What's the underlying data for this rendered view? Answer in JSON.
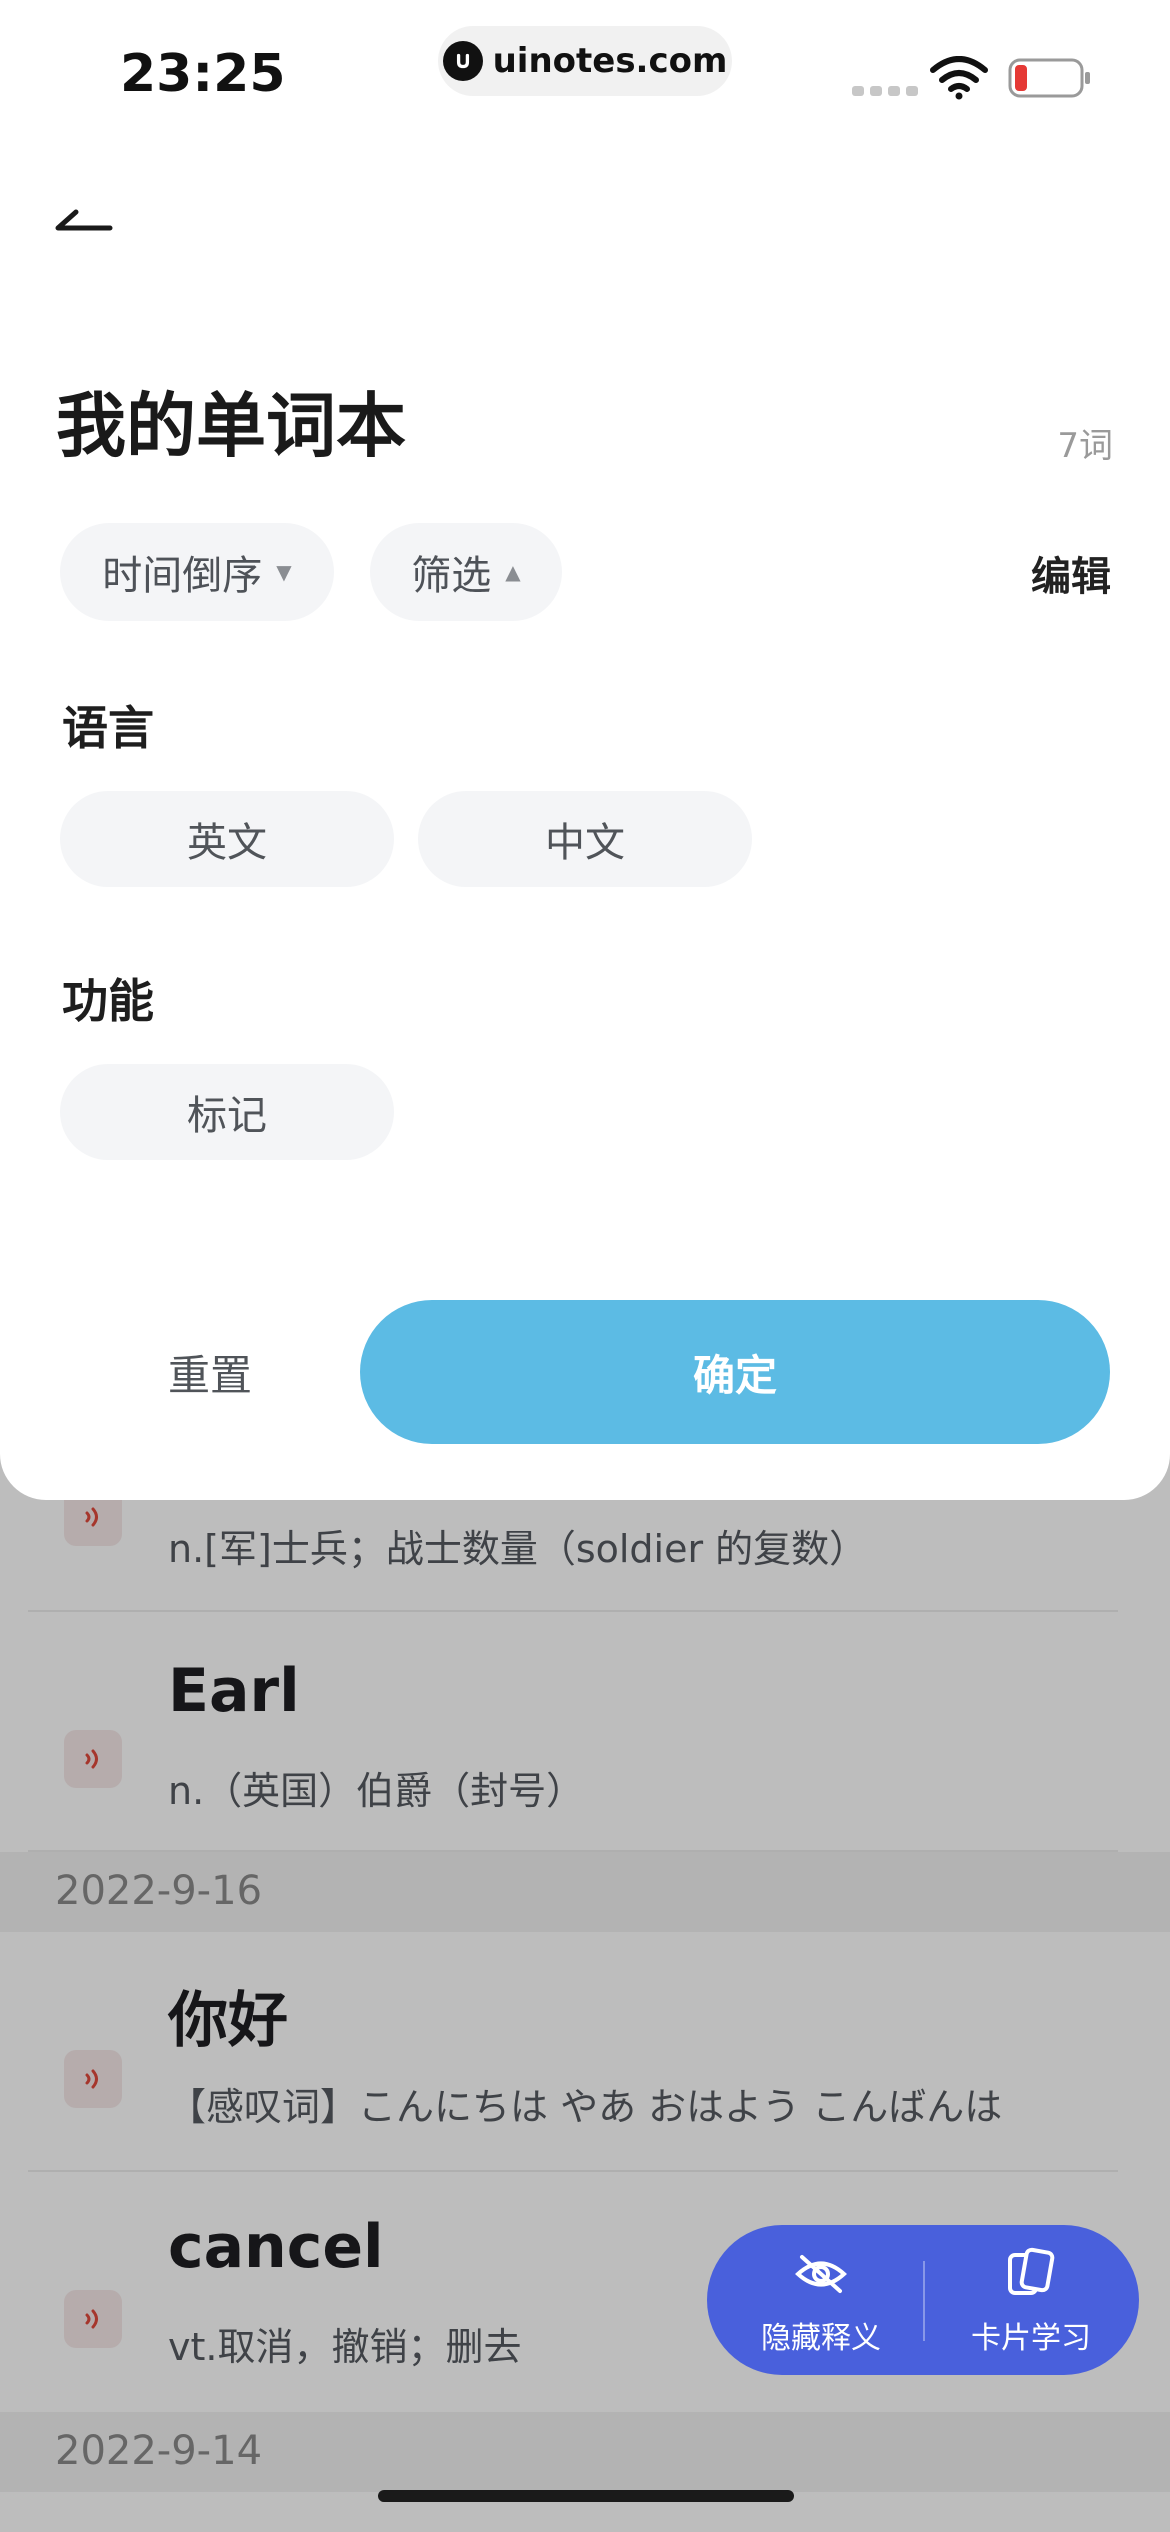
{
  "status_bar": {
    "time": "23:25",
    "url": "uinotes.com",
    "battery_color": "#e53935"
  },
  "header": {
    "back_icon": "back-arrow-icon",
    "title": "我的单词本",
    "word_count": "7词"
  },
  "toolbar": {
    "sort_label": "时间倒序",
    "filter_label": "筛选",
    "edit_label": "编辑"
  },
  "filter_panel": {
    "language_title": "语言",
    "language_options": [
      "英文",
      "中文"
    ],
    "function_title": "功能",
    "function_options": [
      "标记"
    ],
    "reset_label": "重置",
    "confirm_label": "确定",
    "confirm_color": "#5cbbe4"
  },
  "word_list": {
    "items": [
      {
        "word": "",
        "definition": "n.[军]士兵；战士数量（soldier 的复数）"
      },
      {
        "word": "Earl",
        "definition": "n.（英国）伯爵（封号）"
      },
      {
        "word": "你好",
        "definition": "【感叹词】こんにちは やあ おはよう こんばんは"
      },
      {
        "word": "cancel",
        "definition": "vt.取消，撤销；删去"
      }
    ],
    "dates": [
      "2022-9-16",
      "2022-9-14"
    ],
    "speaker_color": "#e04a3c"
  },
  "fab": {
    "hide_label": "隐藏释义",
    "card_label": "卡片学习",
    "color": "#4960dc"
  }
}
